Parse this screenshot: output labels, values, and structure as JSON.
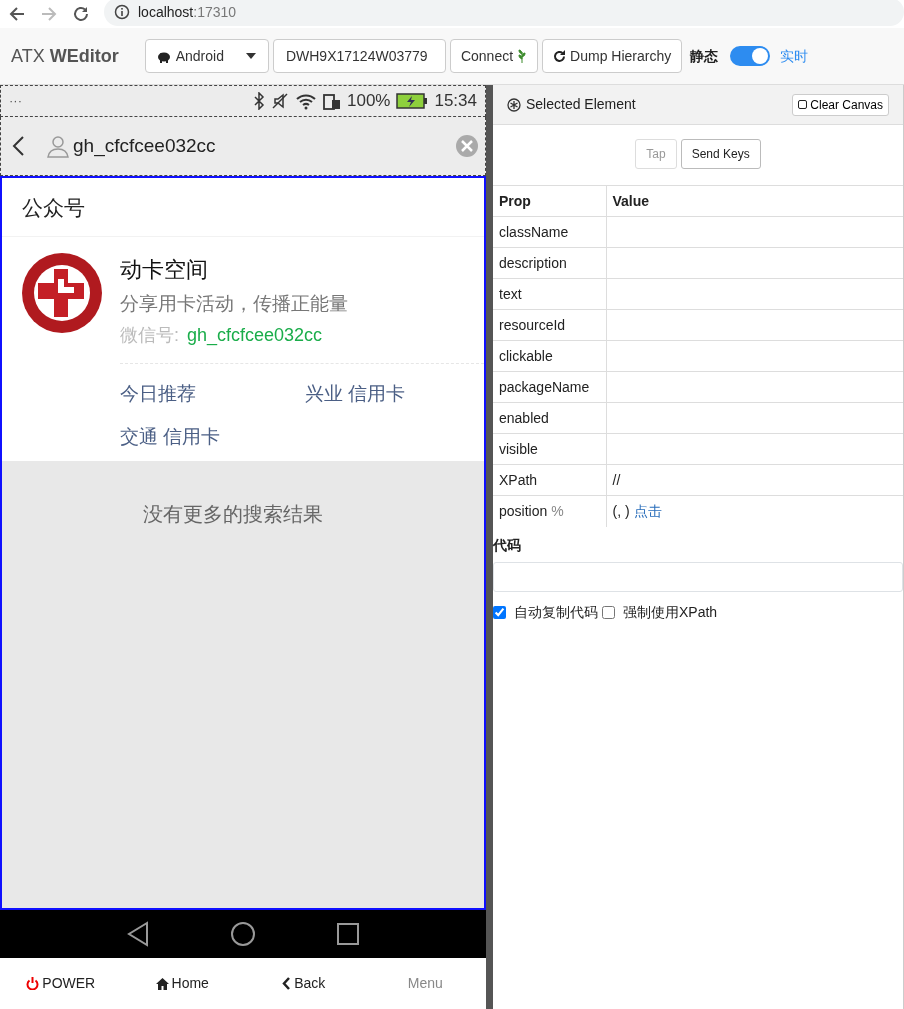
{
  "browser": {
    "back_disabled": false,
    "forward_disabled": true,
    "host": "localhost",
    "port": ":17310"
  },
  "toolbar": {
    "brand": "ATX **WEditor**",
    "platform": "Android",
    "serial": "DWH9X17124W03779",
    "connect": "Connect",
    "dump": "Dump Hierarchy",
    "mode_static": "静态",
    "realtime_on": true,
    "mode_realtime": "实时"
  },
  "phone": {
    "status_bar": {
      "dots": "···",
      "battery": "100%",
      "time": "15:34"
    },
    "title": "gh_cfcfcee032cc",
    "section": "公众号",
    "account": {
      "name": "动卡空间",
      "description": "分享用卡活动，传播正能量",
      "wechat_label": "微信号:",
      "wechat_id": "gh_cfcfcee032cc"
    },
    "links": [
      "今日推荐",
      "兴业 信用卡",
      "交通 信用卡"
    ],
    "no_more": "没有更多的搜索结果"
  },
  "device_buttons": [
    {
      "kind": "power",
      "label": "POWER",
      "disabled": false
    },
    {
      "kind": "home",
      "label": "Home",
      "disabled": false
    },
    {
      "kind": "back",
      "label": "Back",
      "disabled": false
    },
    {
      "kind": "menu",
      "label": "Menu",
      "disabled": true
    }
  ],
  "inspector": {
    "title": "Selected Element",
    "clear": "Clear Canvas",
    "actions": [
      {
        "label": "Tap",
        "disabled": true
      },
      {
        "label": "Send Keys",
        "disabled": false
      }
    ],
    "columns": [
      "Prop",
      "Value"
    ],
    "rows": [
      {
        "prop": "className"
      },
      {
        "prop": "description"
      },
      {
        "prop": "text"
      },
      {
        "prop": "resourceId"
      },
      {
        "prop": "clickable"
      },
      {
        "prop": "packageName"
      },
      {
        "prop": "enabled"
      },
      {
        "prop": "visible"
      },
      {
        "prop": "XPath",
        "value": "//"
      },
      {
        "prop": "position",
        "suffix": "%",
        "value": "(, )",
        "link": "点击"
      }
    ],
    "code_label": "代码",
    "options": [
      {
        "label": "自动复制代码",
        "checked": true
      },
      {
        "label": "强制使用XPath",
        "checked": false
      }
    ]
  }
}
